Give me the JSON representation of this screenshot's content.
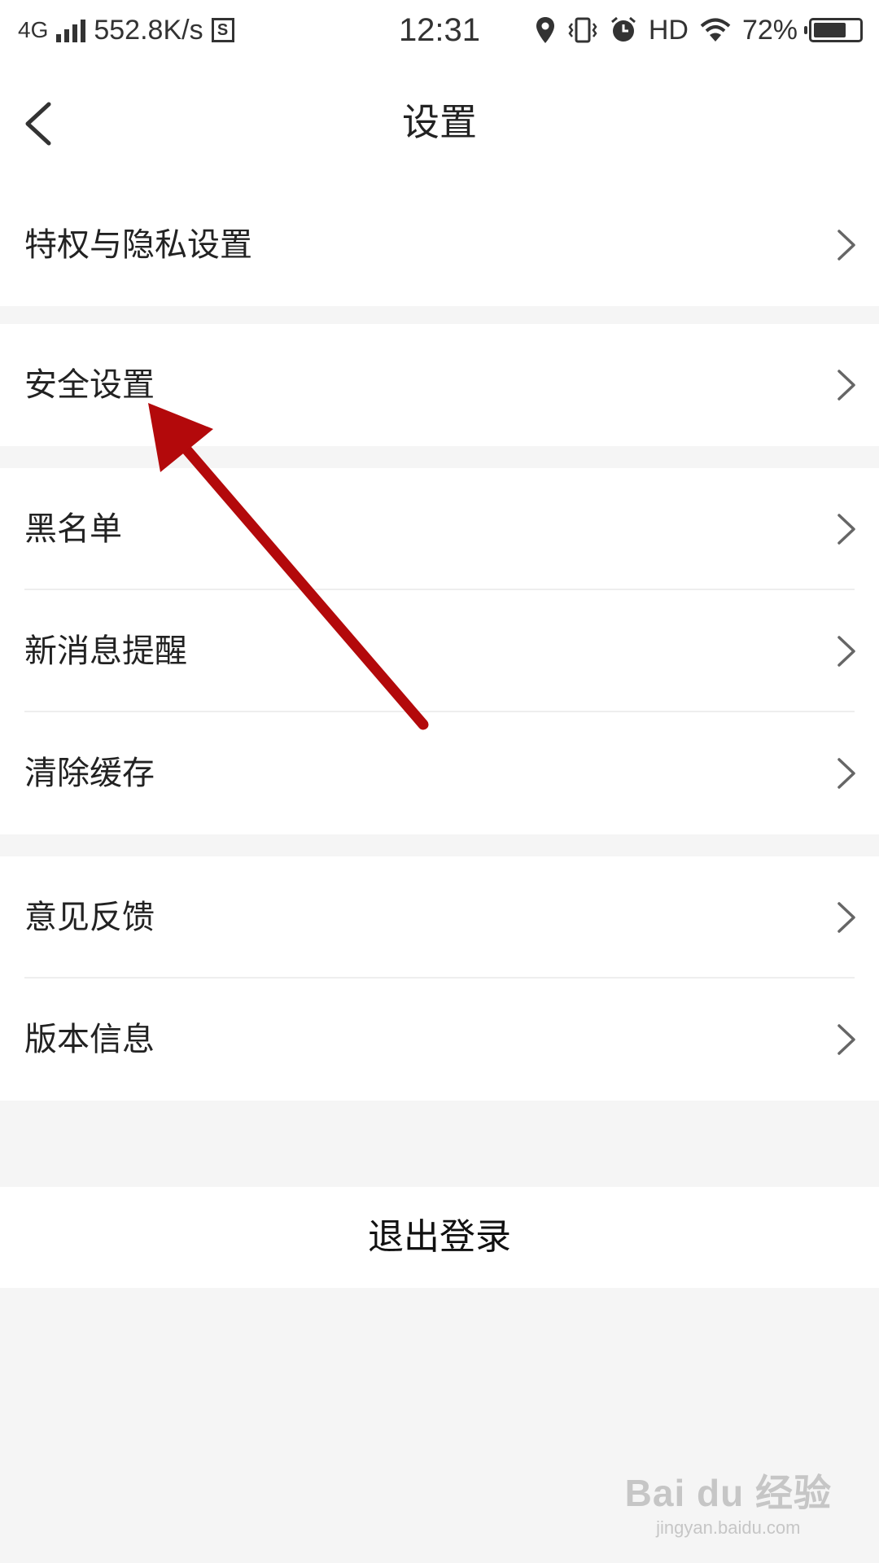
{
  "status_bar": {
    "network": "4G",
    "speed": "552.8K/s",
    "sim_icon": "S",
    "time": "12:31",
    "hd": "HD",
    "battery": "72%",
    "battery_level": 0.72
  },
  "nav": {
    "title": "设置",
    "back_icon": "chevron-left"
  },
  "groups": [
    {
      "items": [
        {
          "label": "特权与隐私设置"
        }
      ]
    },
    {
      "items": [
        {
          "label": "安全设置"
        }
      ]
    },
    {
      "items": [
        {
          "label": "黑名单"
        },
        {
          "label": "新消息提醒"
        },
        {
          "label": "清除缓存"
        }
      ]
    },
    {
      "items": [
        {
          "label": "意见反馈"
        },
        {
          "label": "版本信息"
        }
      ]
    }
  ],
  "logout": {
    "label": "退出登录"
  },
  "annotation": {
    "arrow_color": "#b3090b",
    "points_to": "安全设置"
  },
  "watermark": {
    "main": "Bai du 经验",
    "sub": "jingyan.baidu.com"
  }
}
